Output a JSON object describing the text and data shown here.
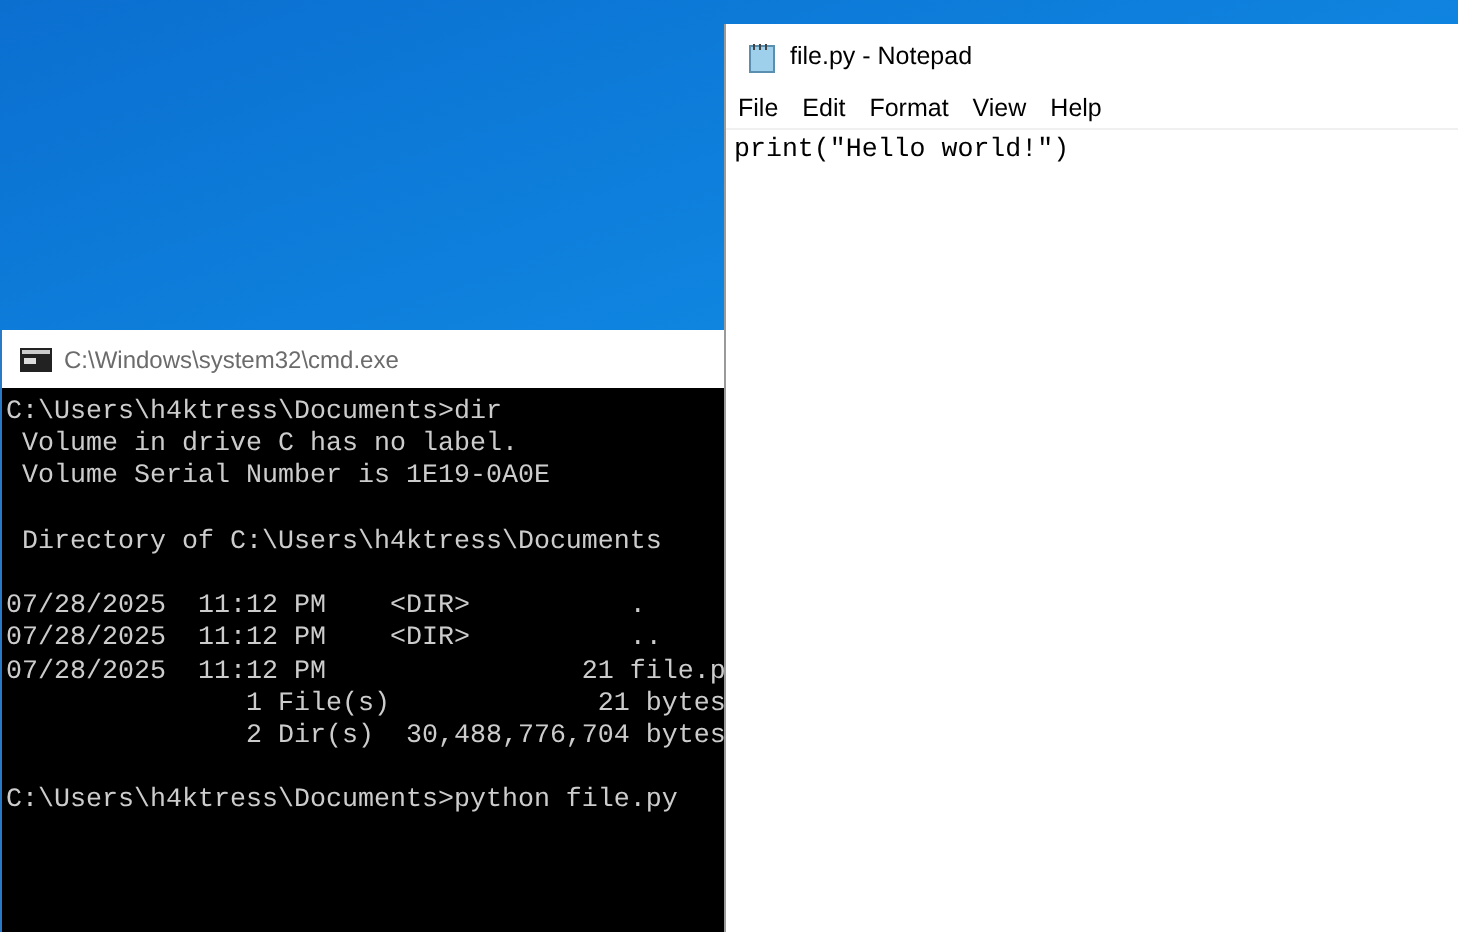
{
  "cmd_window": {
    "title": "C:\\Windows\\system32\\cmd.exe",
    "blocks": [
      [
        "C:\\Users\\h4ktress\\Documents>dir",
        " Volume in drive C has no label.",
        " Volume Serial Number is 1E19-0A0E"
      ],
      [
        " Directory of C:\\Users\\h4ktress\\Documents"
      ],
      [
        "07/28/2025  11:12 PM    <DIR>          .",
        "07/28/2025  11:12 PM    <DIR>          ..",
        "07/28/2025  11:12 PM                21 file.p",
        "               1 File(s)             21 bytes",
        "               2 Dir(s)  30,488,776,704 bytes"
      ],
      [
        "C:\\Users\\h4ktress\\Documents>python file.py"
      ]
    ]
  },
  "notepad_window": {
    "title": "file.py - Notepad",
    "menu": [
      "File",
      "Edit",
      "Format",
      "View",
      "Help"
    ],
    "content": "print(\"Hello world!\")"
  }
}
